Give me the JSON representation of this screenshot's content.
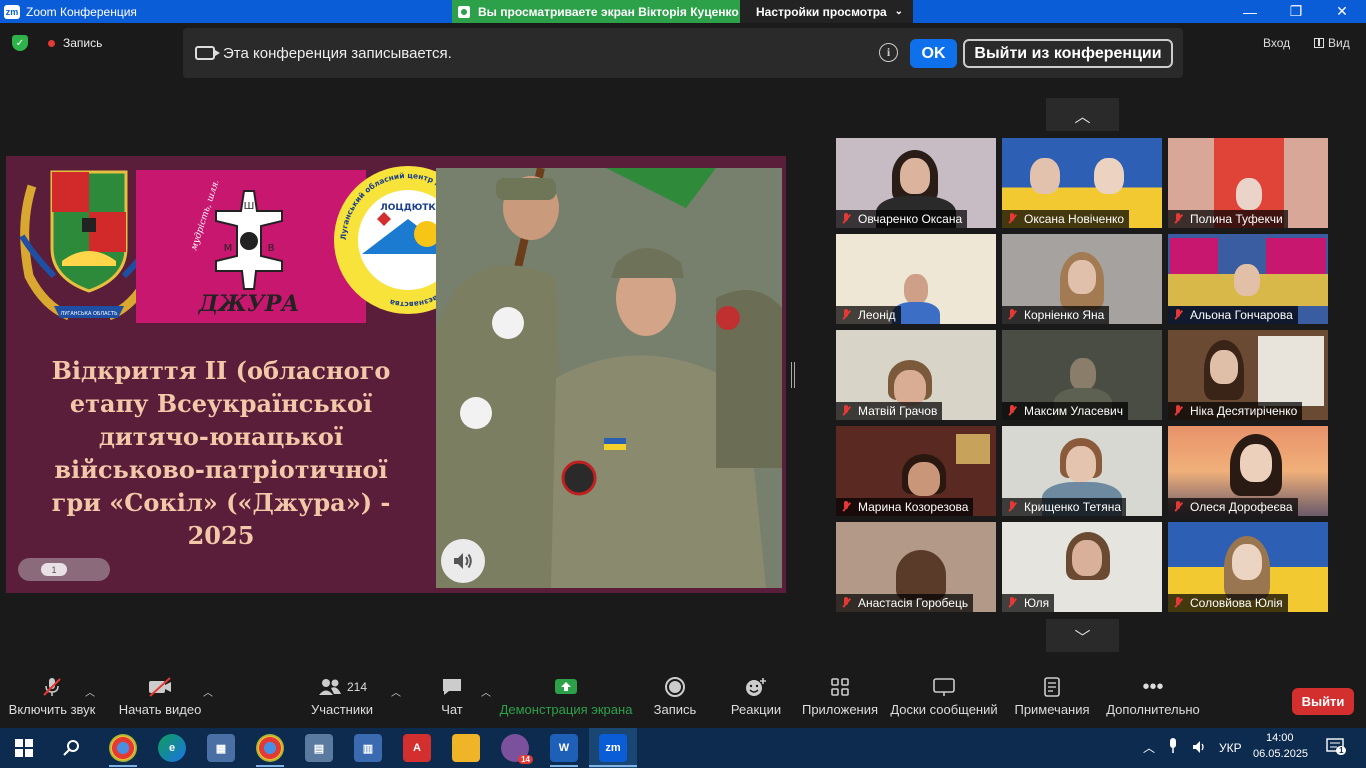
{
  "window": {
    "app_title": "Zoom Конференция",
    "share_notice": "Вы просматриваете экран Вікторія Куценко",
    "view_settings": "Настройки просмотра",
    "controls": {
      "minimize": "—",
      "maximize": "❐",
      "close": "✕"
    }
  },
  "topbar": {
    "recording_label": "Запись",
    "banner_text": "Эта конференция записывается.",
    "ok_label": "OK",
    "leave_conference_label": "Выйти из конференции",
    "enter_label": "Вход",
    "view_label": "Вид"
  },
  "slide": {
    "title_lines": [
      "Відкриття ІІ (обласного",
      "етапу Всеукраїнської",
      "дитячо-юнацької",
      "військово-патріотичної",
      "гри «Сокіл» («Джура») - 2025"
    ],
    "page_number": "1",
    "logo_motto": "мудрість, шляхетність, відвага",
    "logo_name": "ДЖУРА",
    "logo_letters": [
      "Ш",
      "М",
      "В"
    ],
    "circle_text": "Луганський обласний центр дитячо-юнацького туризму і краєзнавства",
    "circle_inner": "ЛОЦДЮТК",
    "emblem_ribbon": "ЛУГАНСЬКА ОБЛАСТЬ"
  },
  "gallery": {
    "scroll_up_icon": "chevron-up-icon",
    "scroll_down_icon": "chevron-down-icon",
    "participants": [
      {
        "name": "Овчаренко Оксана"
      },
      {
        "name": "Оксана Новіченко"
      },
      {
        "name": "Полина Туфекчи"
      },
      {
        "name": "Леонід"
      },
      {
        "name": "Корніенко Яна"
      },
      {
        "name": "Альона Гончарова"
      },
      {
        "name": "Матвій Грачов"
      },
      {
        "name": "Максим Уласевич"
      },
      {
        "name": "Ніка Десятиріченко"
      },
      {
        "name": "Марина Козорезова"
      },
      {
        "name": "Крищенко Тетяна"
      },
      {
        "name": "Олеся Дорофеєва"
      },
      {
        "name": "Анастасія Горобець"
      },
      {
        "name": "Юля"
      },
      {
        "name": "Соловйова Юлія"
      }
    ]
  },
  "toolbar": {
    "unmute": "Включить звук",
    "start_video": "Начать видео",
    "participants": "Участники",
    "participants_count": "214",
    "chat": "Чат",
    "share_screen": "Демонстрация экрана",
    "record": "Запись",
    "reactions": "Реакции",
    "apps": "Приложения",
    "whiteboards": "Доски сообщений",
    "notes": "Примечания",
    "more": "Дополнительно",
    "leave": "Выйти",
    "colors": {
      "share_green": "#2ca14a",
      "leave_red": "#d32f2f",
      "accent_blue": "#0e71eb"
    }
  },
  "taskbar": {
    "language": "УКР",
    "time": "14:00",
    "date": "06.05.2025",
    "viber_badge": "14",
    "notification_badge": "1",
    "zoom_label": "zm"
  }
}
